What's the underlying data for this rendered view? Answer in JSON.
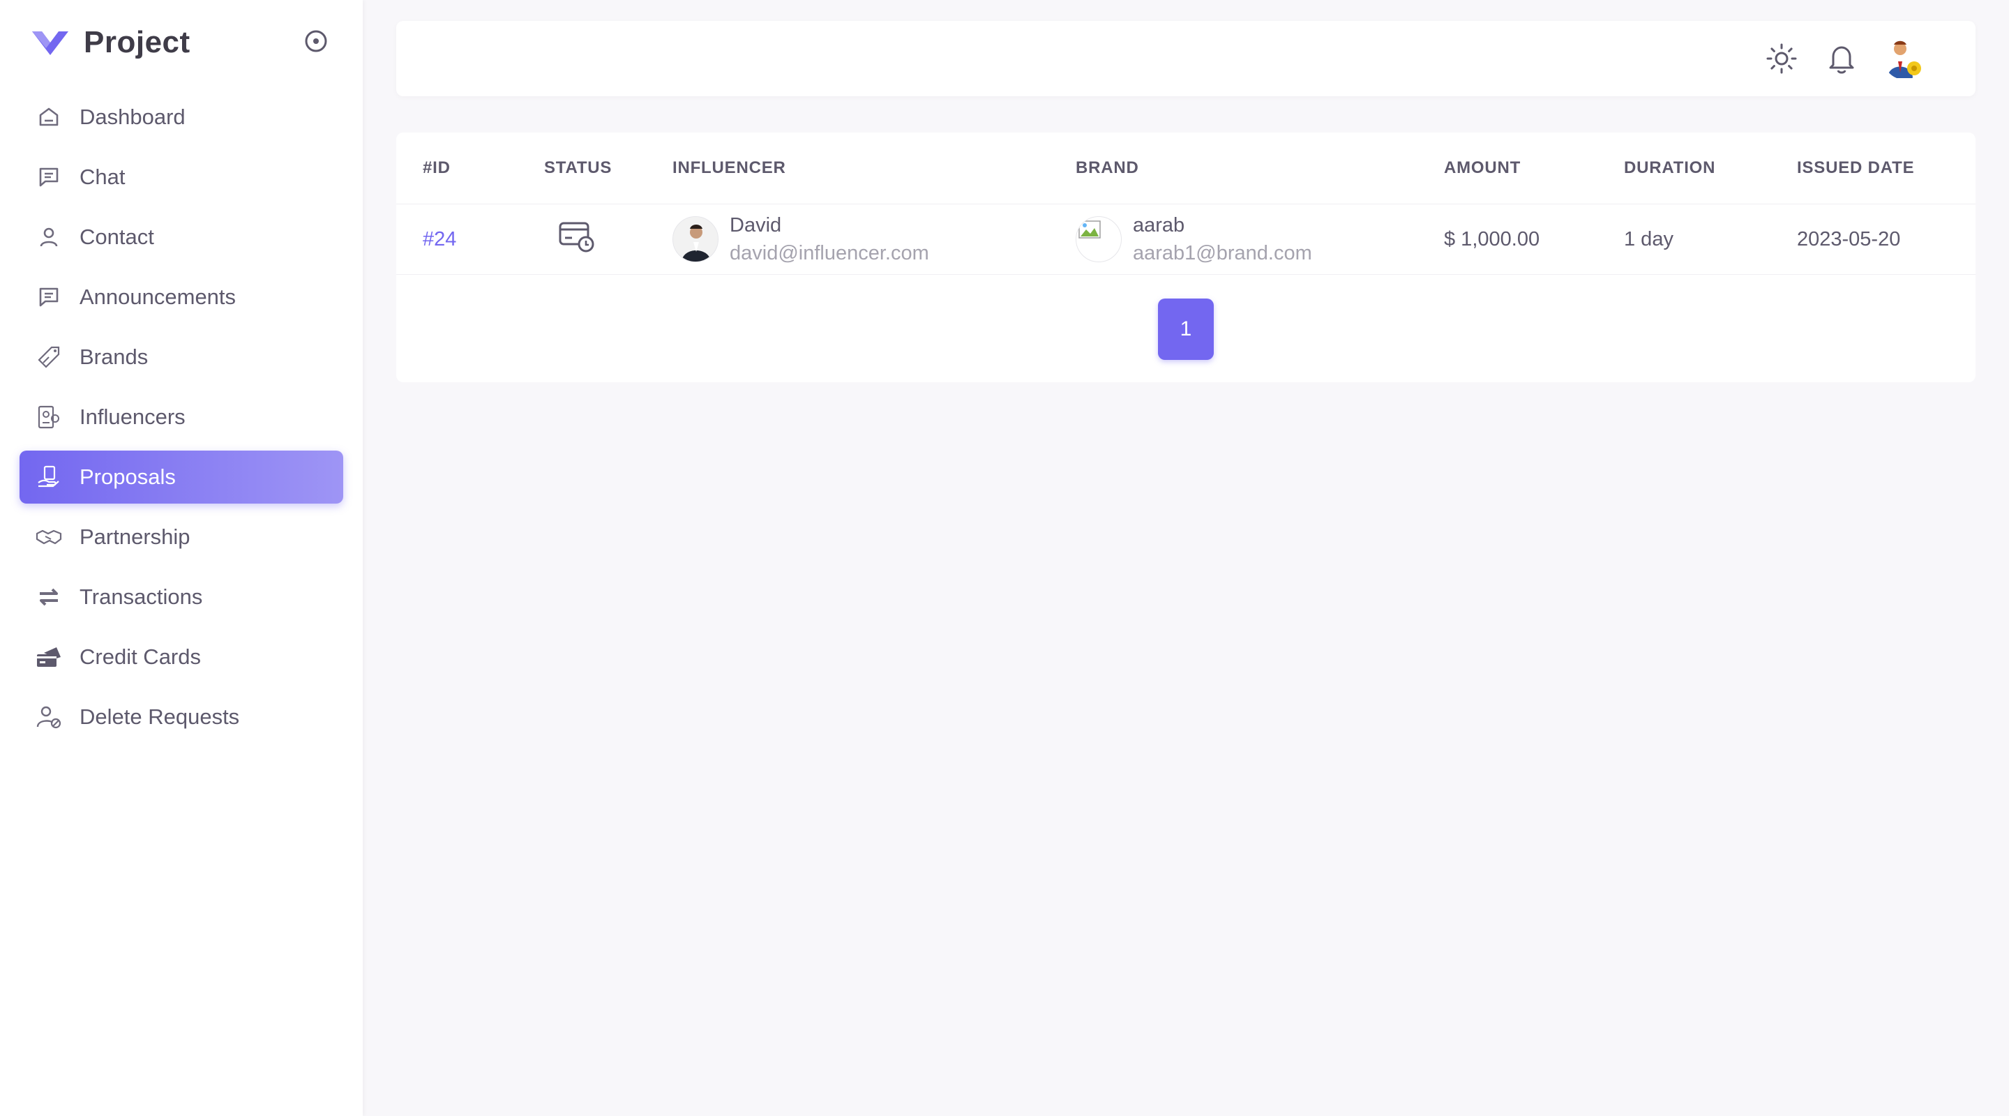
{
  "brand": {
    "title": "Project",
    "accent": "#7367f0"
  },
  "sidebar": {
    "items": [
      {
        "label": "Dashboard",
        "icon": "home-icon"
      },
      {
        "label": "Chat",
        "icon": "chat-icon"
      },
      {
        "label": "Contact",
        "icon": "user-icon"
      },
      {
        "label": "Announcements",
        "icon": "message-icon"
      },
      {
        "label": "Brands",
        "icon": "tag-icon"
      },
      {
        "label": "Influencers",
        "icon": "influencer-icon"
      },
      {
        "label": "Proposals",
        "icon": "proposal-icon",
        "active": true
      },
      {
        "label": "Partnership",
        "icon": "handshake-icon"
      },
      {
        "label": "Transactions",
        "icon": "arrows-exchange-icon"
      },
      {
        "label": "Credit Cards",
        "icon": "credit-card-icon"
      },
      {
        "label": "Delete Requests",
        "icon": "user-delete-icon"
      }
    ]
  },
  "navbar": {
    "icons": [
      "sun-icon",
      "bell-icon",
      "user-avatar"
    ]
  },
  "table": {
    "headers": [
      "#ID",
      "STATUS",
      "INFLUENCER",
      "BRAND",
      "AMOUNT",
      "DURATION",
      "ISSUED DATE"
    ],
    "rows": [
      {
        "id": "#24",
        "status_icon": "card-clock-icon",
        "influencer": {
          "name": "David",
          "email": "david@influencer.com"
        },
        "brand": {
          "name": "aarab",
          "email": "aarab1@brand.com"
        },
        "amount": "$ 1,000.00",
        "duration": "1 day",
        "issued_date": "2023-05-20"
      }
    ]
  },
  "pagination": {
    "current": "1"
  }
}
